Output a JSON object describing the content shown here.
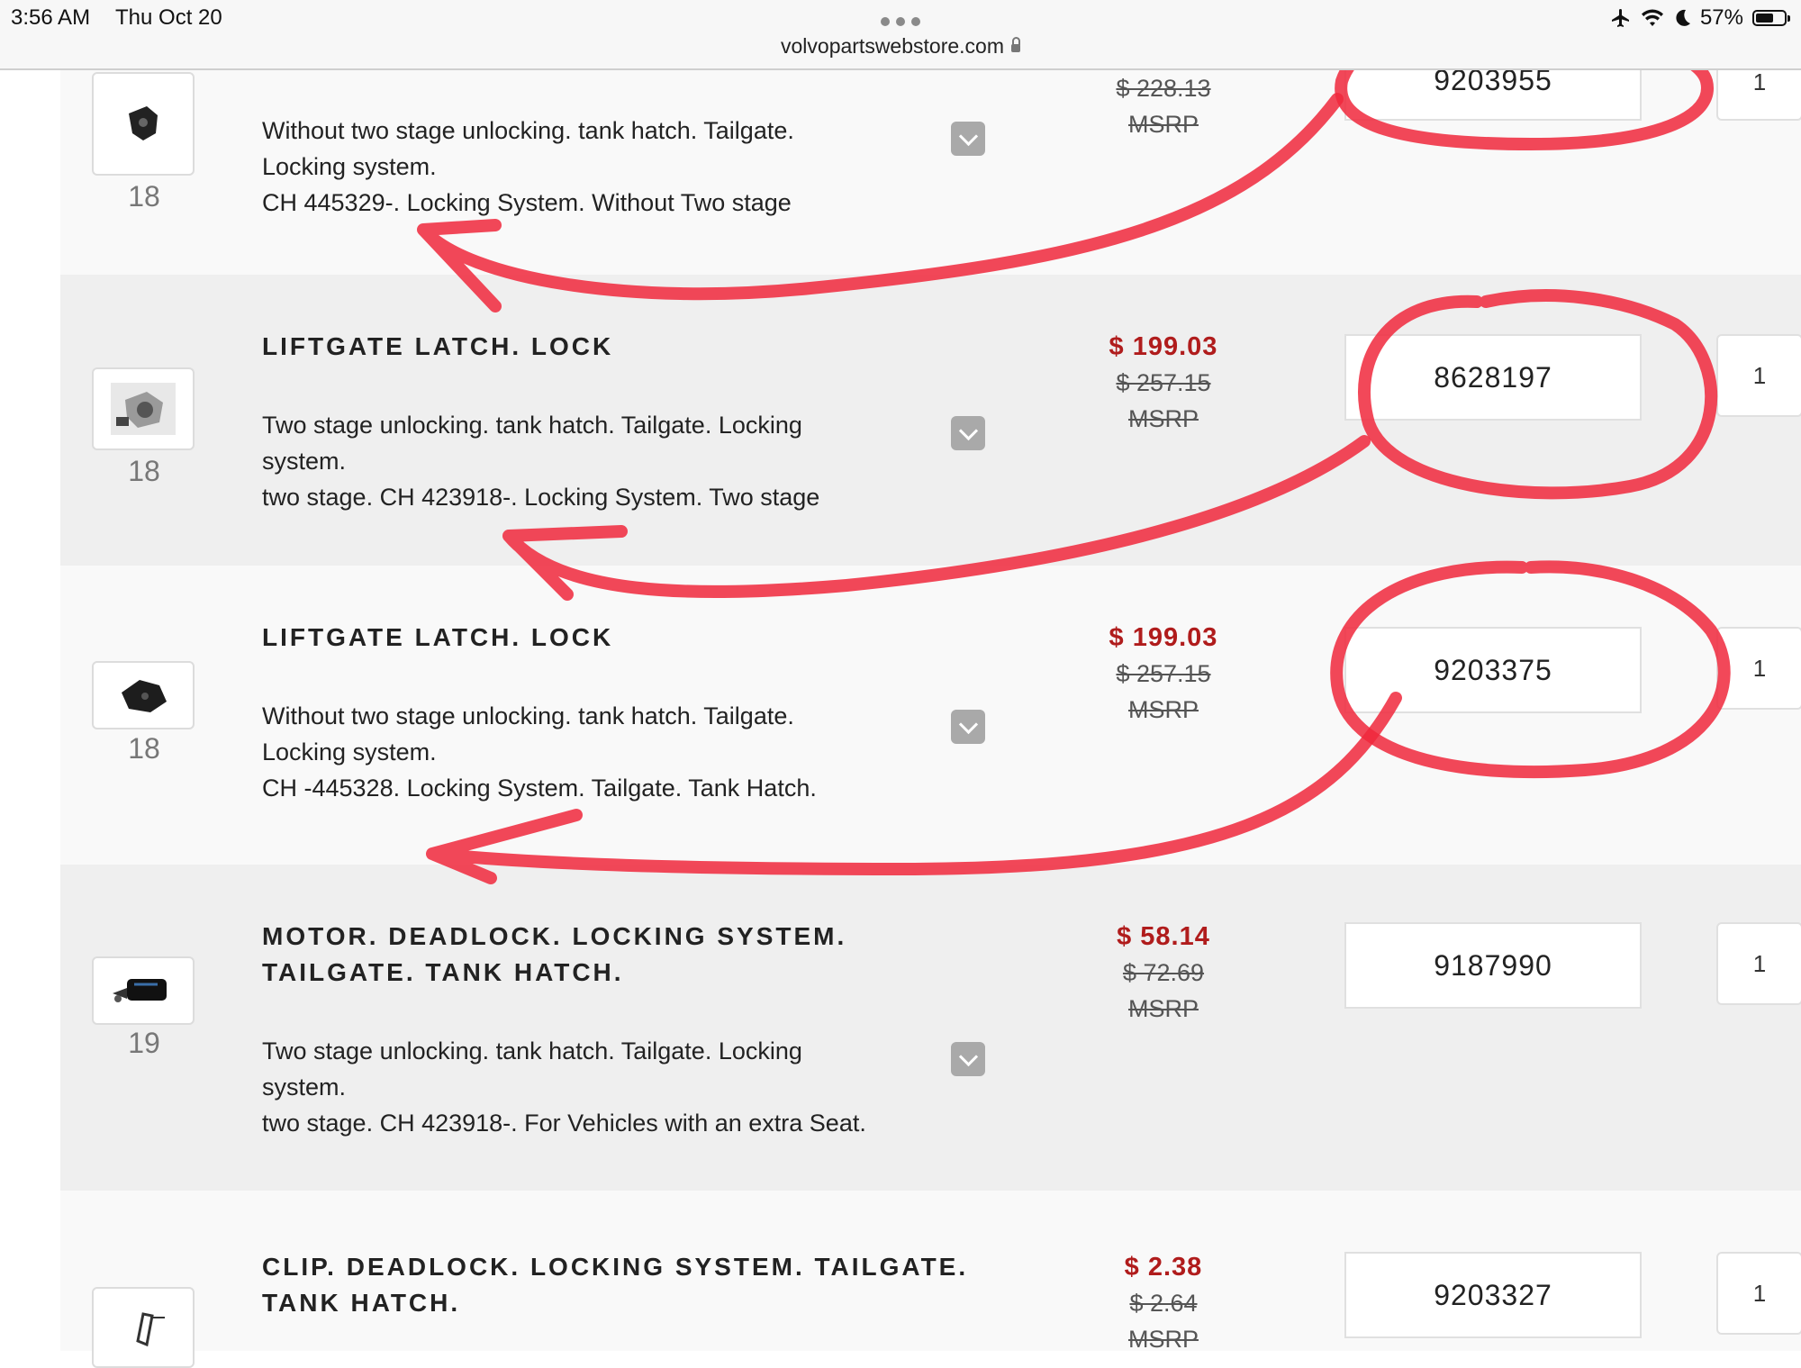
{
  "status_bar": {
    "time": "3:56 AM",
    "date": "Thu Oct 20",
    "url": "volvopartswebstore.com",
    "battery": "57%",
    "icons": [
      "airplane-icon",
      "wifi-icon",
      "moon-icon",
      "battery-icon"
    ]
  },
  "colors": {
    "sale_price": "#b01c1c",
    "annotation": "#f0283c",
    "row_alt": "#efefef",
    "row_plain": "#f9f9f9"
  },
  "parts": [
    {
      "ref": "18",
      "title": "",
      "desc_lines": [
        "Without two stage unlocking. tank hatch. Tailgate.",
        "Locking system.",
        "CH 445329-. Locking System. Without Two stage"
      ],
      "price": "",
      "msrp": "$ 228.13",
      "msrp_label": "MSRP",
      "part_number": "9203955",
      "qty": "1"
    },
    {
      "ref": "18",
      "title": "LIFTGATE LATCH. LOCK",
      "desc_lines": [
        "Two stage unlocking. tank hatch. Tailgate. Locking",
        "system.",
        "two stage. CH 423918-. Locking System. Two stage"
      ],
      "price": "$ 199.03",
      "msrp": "$ 257.15",
      "msrp_label": "MSRP",
      "part_number": "8628197",
      "qty": "1"
    },
    {
      "ref": "18",
      "title": "LIFTGATE LATCH. LOCK",
      "desc_lines": [
        "Without two stage unlocking. tank hatch. Tailgate.",
        "Locking system.",
        "CH -445328. Locking System. Tailgate. Tank Hatch."
      ],
      "price": "$ 199.03",
      "msrp": "$ 257.15",
      "msrp_label": "MSRP",
      "part_number": "9203375",
      "qty": "1"
    },
    {
      "ref": "19",
      "title_lines": [
        "MOTOR. DEADLOCK. LOCKING SYSTEM.",
        "TAILGATE. TANK HATCH."
      ],
      "desc_lines": [
        "Two stage unlocking. tank hatch. Tailgate. Locking",
        "system.",
        "two stage. CH 423918-. For Vehicles with an extra Seat."
      ],
      "price": "$ 58.14",
      "msrp": "$ 72.69",
      "msrp_label": "MSRP",
      "part_number": "9187990",
      "qty": "1"
    },
    {
      "ref": "",
      "title_lines": [
        "CLIP. DEADLOCK. LOCKING SYSTEM. TAILGATE.",
        "TANK HATCH."
      ],
      "desc_lines": [],
      "price": "$ 2.38",
      "msrp": "$ 2.64",
      "msrp_label": "MSRP",
      "part_number": "9203327",
      "qty": "1"
    }
  ]
}
